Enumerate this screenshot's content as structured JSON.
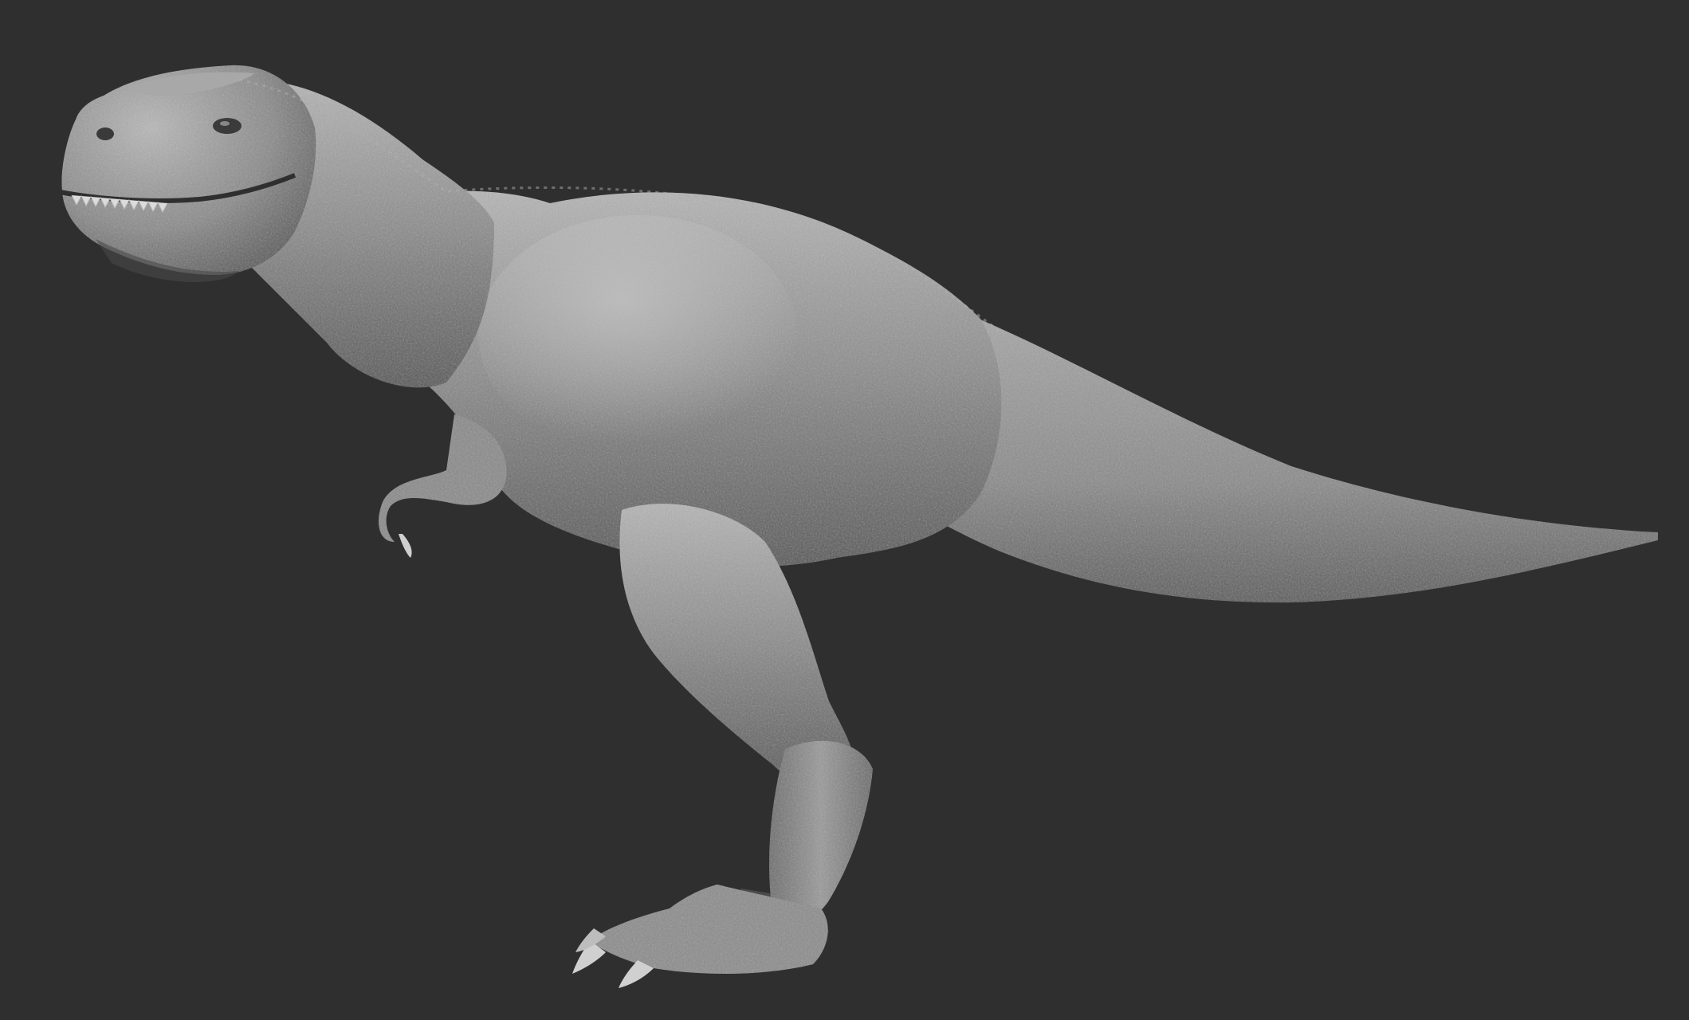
{
  "scene": {
    "subject": "t-rex-sculpt",
    "background_color": "#2f2f2f",
    "material_color": "#8e8e8e",
    "highlight_color": "#c2c2c2",
    "shadow_color": "#3e3e3e"
  }
}
